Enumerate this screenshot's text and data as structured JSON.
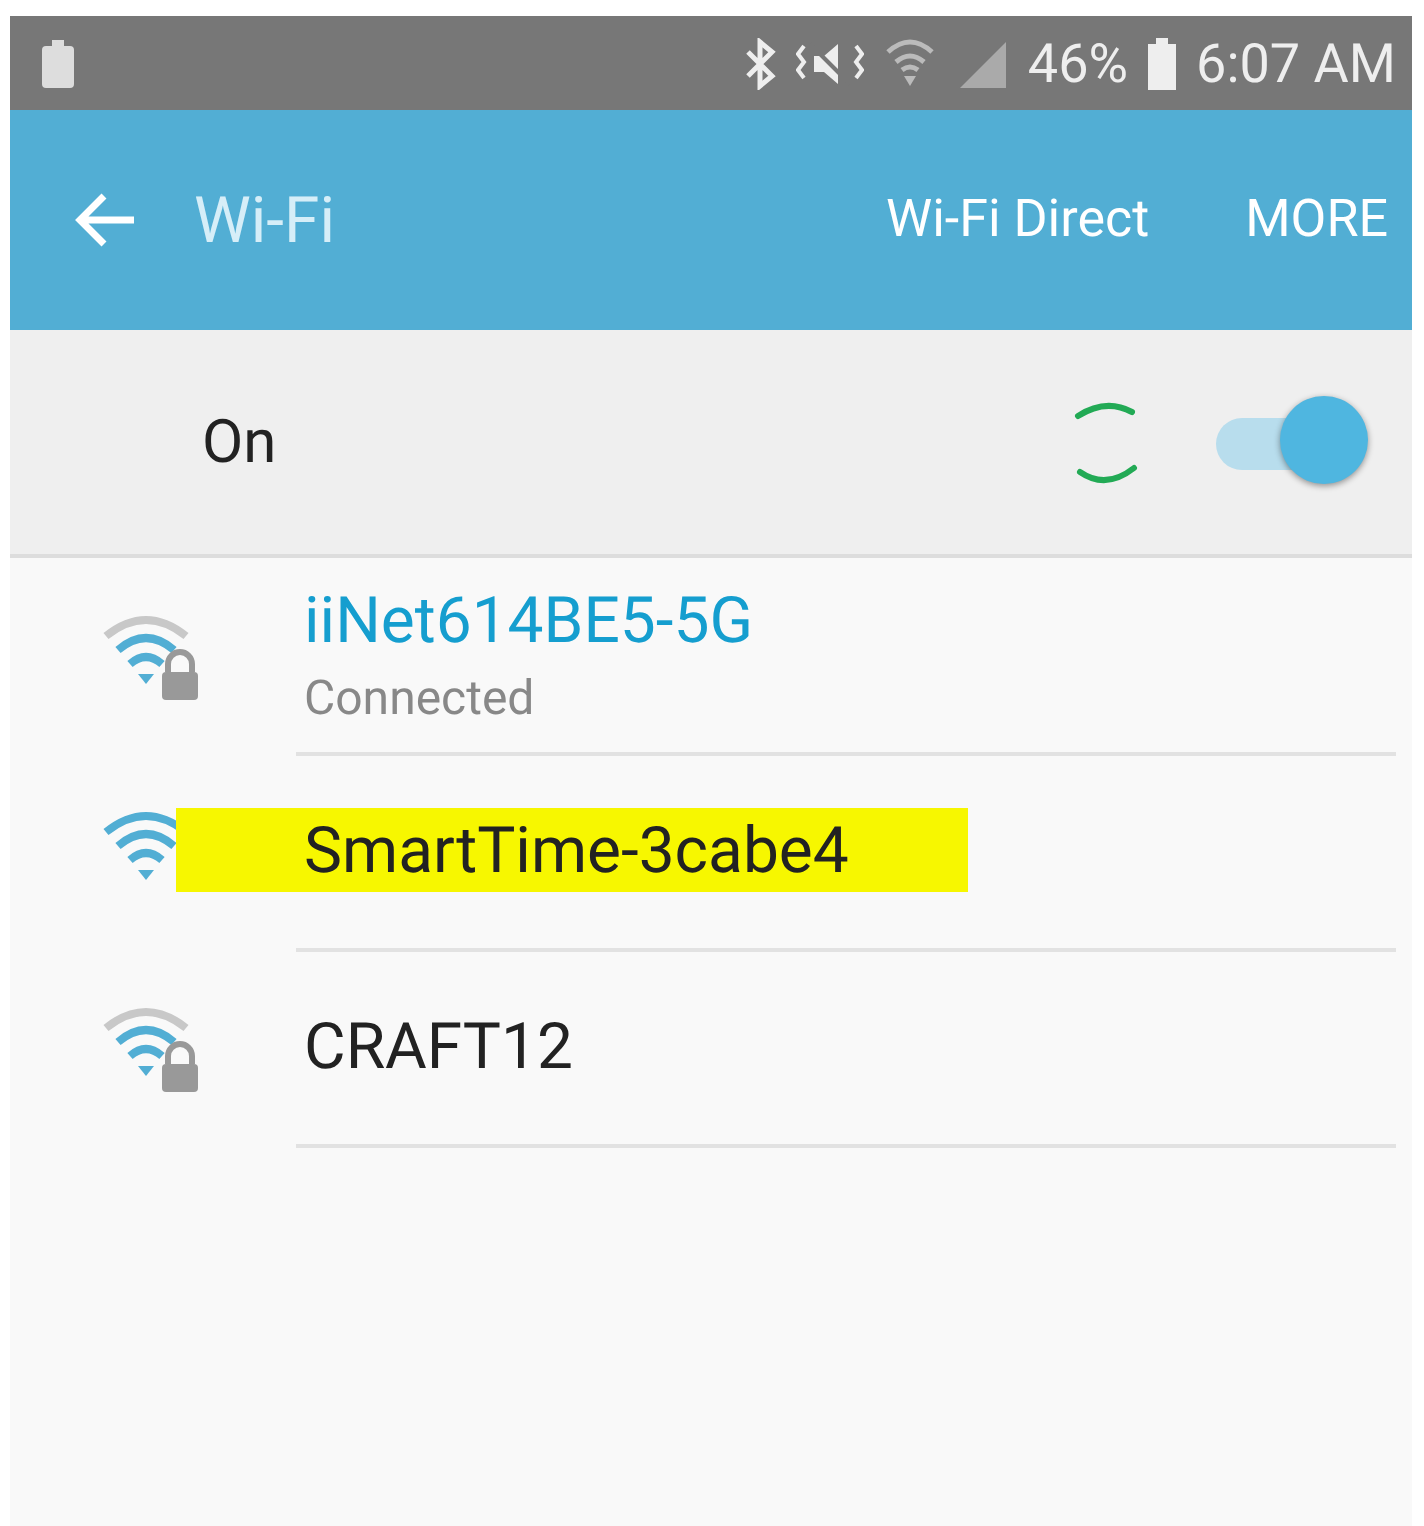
{
  "status_bar": {
    "battery_percent": "46%",
    "time": "6:07 AM"
  },
  "app_bar": {
    "title": "Wi-Fi",
    "actions": [
      "Wi-Fi Direct",
      "MORE"
    ]
  },
  "master_switch": {
    "label": "On",
    "on": true
  },
  "networks": [
    {
      "name": "iiNet614BE5-5G",
      "status": "Connected",
      "connected": true,
      "locked": true,
      "highlighted": false
    },
    {
      "name": "SmartTime-3cabe4",
      "connected": false,
      "locked": false,
      "highlighted": true
    },
    {
      "name": "CRAFT12",
      "connected": false,
      "locked": true,
      "highlighted": false
    }
  ]
}
